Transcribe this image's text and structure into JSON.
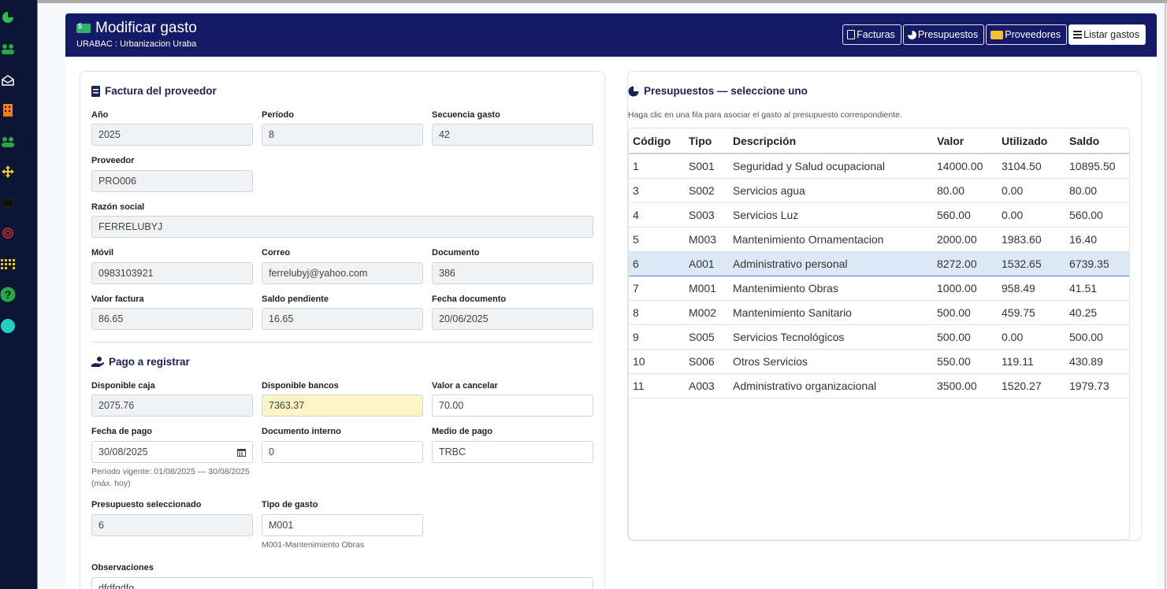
{
  "colors": {
    "header_bg": "#141a66",
    "highlight_field": "#fcf4c4",
    "selected_row": "#dde8f7"
  },
  "sidebar": {
    "icons": [
      "chart-pie-icon",
      "users-icon",
      "envelope-icon",
      "building-icon",
      "users-icon",
      "arrows-icon",
      "envelope-icon",
      "fingerprint-icon",
      "grid-icon",
      "question-icon",
      "dot-icon"
    ]
  },
  "header": {
    "title": "Modificar gasto",
    "subtitle": "URABAC : Urbanizacion Uraba",
    "buttons": [
      {
        "label": "Facturas",
        "icon": "file-invoice-icon"
      },
      {
        "label": "Presupuestos",
        "icon": "chart-pie-icon"
      },
      {
        "label": "Proveedores",
        "icon": "truck-icon"
      },
      {
        "label": "Listar gastos",
        "icon": "list-icon"
      }
    ]
  },
  "factura": {
    "title": "Factura del proveedor",
    "anio_label": "Año",
    "anio": "2025",
    "periodo_label": "Período",
    "periodo": "8",
    "secuencia_label": "Secuencia gasto",
    "secuencia": "42",
    "proveedor_label": "Proveedor",
    "proveedor": "PRO006",
    "razon_label": "Razón social",
    "razon": "FERRELUBYJ",
    "movil_label": "Móvil",
    "movil": "0983103921",
    "correo_label": "Correo",
    "correo": "ferrelubyj@yahoo.com",
    "documento_label": "Documento",
    "documento": "386",
    "valor_label": "Valor factura",
    "valor": "86.65",
    "saldo_label": "Saldo pendiente",
    "saldo": "16.65",
    "fecha_doc_label": "Fecha documento",
    "fecha_doc": "20/06/2025"
  },
  "pago": {
    "title": "Pago a registrar",
    "caja_label": "Disponible caja",
    "caja": "2075.76",
    "bancos_label": "Disponible bancos",
    "bancos": "7363.37",
    "cancelar_label": "Valor a cancelar",
    "cancelar": "70.00",
    "fecha_label": "Fecha de pago",
    "fecha": "30/08/2025",
    "fecha_help": "Período vigente: 01/08/2025 — 30/08/2025 (máx. hoy)",
    "doc_interno_label": "Documento interno",
    "doc_interno": "0",
    "medio_label": "Medio de pago",
    "medio": "TRBC",
    "presupuesto_label": "Presupuesto seleccionado",
    "presupuesto": "6",
    "tipo_label": "Tipo de gasto",
    "tipo": "M001",
    "tipo_help": "M001-Mantenimiento Obras",
    "obs_label": "Observaciones",
    "obs": "dfdfgdfg"
  },
  "presupuestos": {
    "title": "Presupuestos — seleccione uno",
    "note": "Haga clic en una fila para asociar el gasto al presupuesto correspondiente.",
    "columns": [
      "Código",
      "Tipo",
      "Descripción",
      "Valor",
      "Utilizado",
      "Saldo"
    ],
    "selected": "6",
    "rows": [
      [
        "1",
        "S001",
        "Seguridad y Salud ocupacional",
        "14000.00",
        "3104.50",
        "10895.50"
      ],
      [
        "3",
        "S002",
        "Servicios agua",
        "80.00",
        "0.00",
        "80.00"
      ],
      [
        "4",
        "S003",
        "Servicios Luz",
        "560.00",
        "0.00",
        "560.00"
      ],
      [
        "5",
        "M003",
        "Mantenimiento Ornamentacion",
        "2000.00",
        "1983.60",
        "16.40"
      ],
      [
        "6",
        "A001",
        "Administrativo personal",
        "8272.00",
        "1532.65",
        "6739.35"
      ],
      [
        "7",
        "M001",
        "Mantenimiento Obras",
        "1000.00",
        "958.49",
        "41.51"
      ],
      [
        "8",
        "M002",
        "Mantenimiento Sanitario",
        "500.00",
        "459.75",
        "40.25"
      ],
      [
        "9",
        "S005",
        "Servicios Tecnológicos",
        "500.00",
        "0.00",
        "500.00"
      ],
      [
        "10",
        "S006",
        "Otros Servicios",
        "550.00",
        "119.11",
        "430.89"
      ],
      [
        "11",
        "A003",
        "Administrativo organizacional",
        "3500.00",
        "1520.27",
        "1979.73"
      ]
    ]
  }
}
